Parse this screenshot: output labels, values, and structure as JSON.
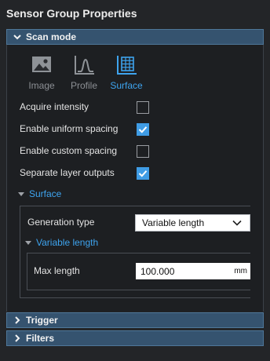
{
  "panel": {
    "title": "Sensor Group Properties"
  },
  "scan_mode": {
    "header": "Scan mode",
    "modes": [
      {
        "label": "Image",
        "icon": "image-icon",
        "active": false
      },
      {
        "label": "Profile",
        "icon": "profile-icon",
        "active": false
      },
      {
        "label": "Surface",
        "icon": "surface-icon",
        "active": true
      }
    ],
    "options": [
      {
        "label": "Acquire intensity",
        "checked": false
      },
      {
        "label": "Enable uniform spacing",
        "checked": true
      },
      {
        "label": "Enable custom spacing",
        "checked": false
      },
      {
        "label": "Separate layer outputs",
        "checked": true
      }
    ],
    "surface": {
      "header": "Surface",
      "generation_type_label": "Generation type",
      "generation_type_value": "Variable length",
      "variable_length": {
        "header": "Variable length",
        "max_length_label": "Max length",
        "max_length_value": "100.000",
        "max_length_unit": "mm"
      }
    }
  },
  "sections": [
    {
      "header": "Trigger"
    },
    {
      "header": "Filters"
    }
  ],
  "colors": {
    "accent": "#3ea4ef",
    "header_bg": "#35536f",
    "checkbox_checked": "#3f9ce5"
  }
}
